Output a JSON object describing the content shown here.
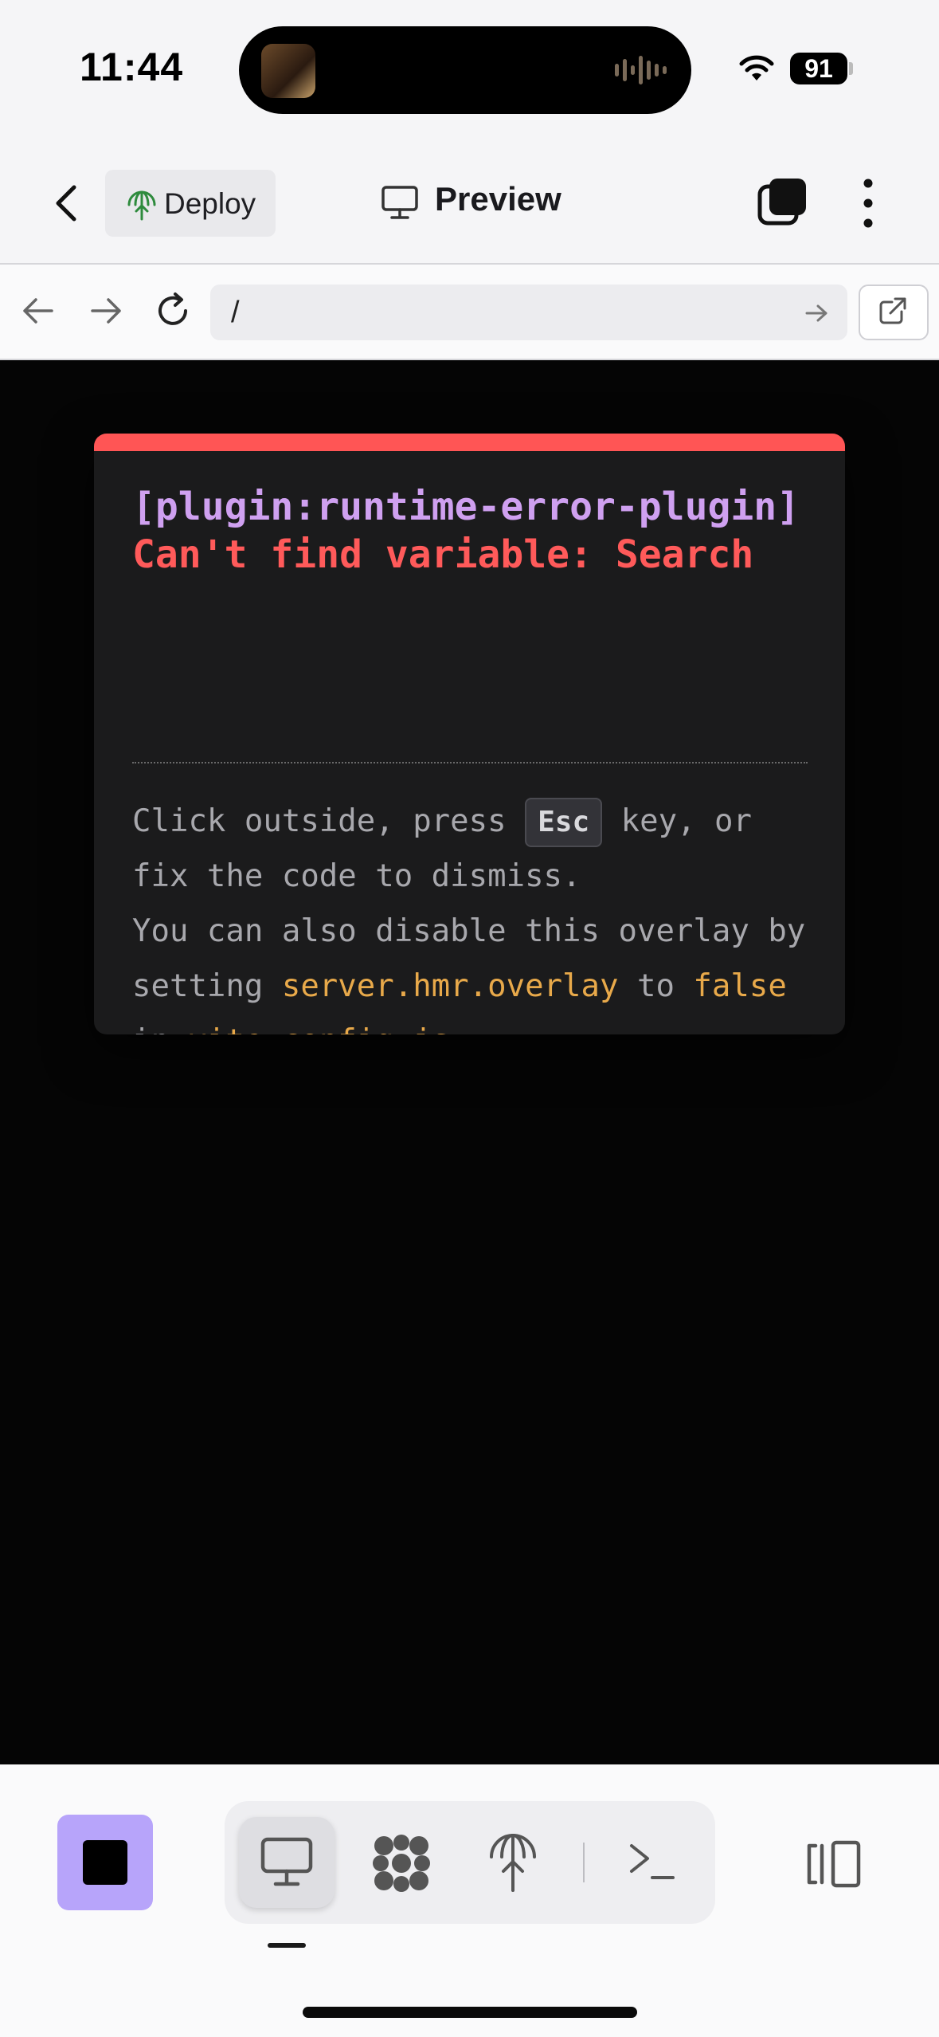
{
  "status_bar": {
    "time": "11:44",
    "battery_level": "91",
    "icons": [
      "now-playing-artwork",
      "audio-waveform-icon",
      "wifi-icon",
      "battery-icon"
    ]
  },
  "top_bar": {
    "back_icon": "chevron-left-icon",
    "deploy_label": "Deploy",
    "deploy_icon": "deploy-globe-arrow-icon",
    "preview_label": "Preview",
    "preview_icon": "monitor-icon",
    "window_icon": "stacked-windows-icon",
    "more_icon": "vertical-dots-icon"
  },
  "url_bar": {
    "url": "/",
    "icons": [
      "arrow-left-icon",
      "arrow-right-icon",
      "reload-icon",
      "go-arrow-icon",
      "external-link-icon"
    ]
  },
  "error_overlay": {
    "plugin": "[plugin:runtime-error-plugin]",
    "message": "Can't find variable: Search",
    "tip_part1": "Click outside, press ",
    "tip_key": "Esc",
    "tip_part2": " key, or",
    "tip_line2": "fix the code to dismiss.",
    "tip_line3": "You can also disable this overlay by",
    "tip_line4_pre": "setting ",
    "tip_code1": "server.hmr.overlay",
    "tip_line4_mid": " to ",
    "tip_code2": "false",
    "tip_line5_pre": "in ",
    "tip_code3": "vite.config.js",
    "tip_line5_post": ".",
    "colors": {
      "top_border": "#ff5555",
      "plugin": "#cfa0f0",
      "message": "#ff5a5a",
      "code": "#e8a94a"
    }
  },
  "bottom_toolbar": {
    "stop_button_color": "#b7a4fa",
    "tabs": [
      "monitor-icon",
      "packages-icon",
      "deploy-globe-arrow-icon",
      "terminal-icon"
    ],
    "active_tab": "monitor-icon",
    "split_view_icon": "split-view-icon"
  }
}
